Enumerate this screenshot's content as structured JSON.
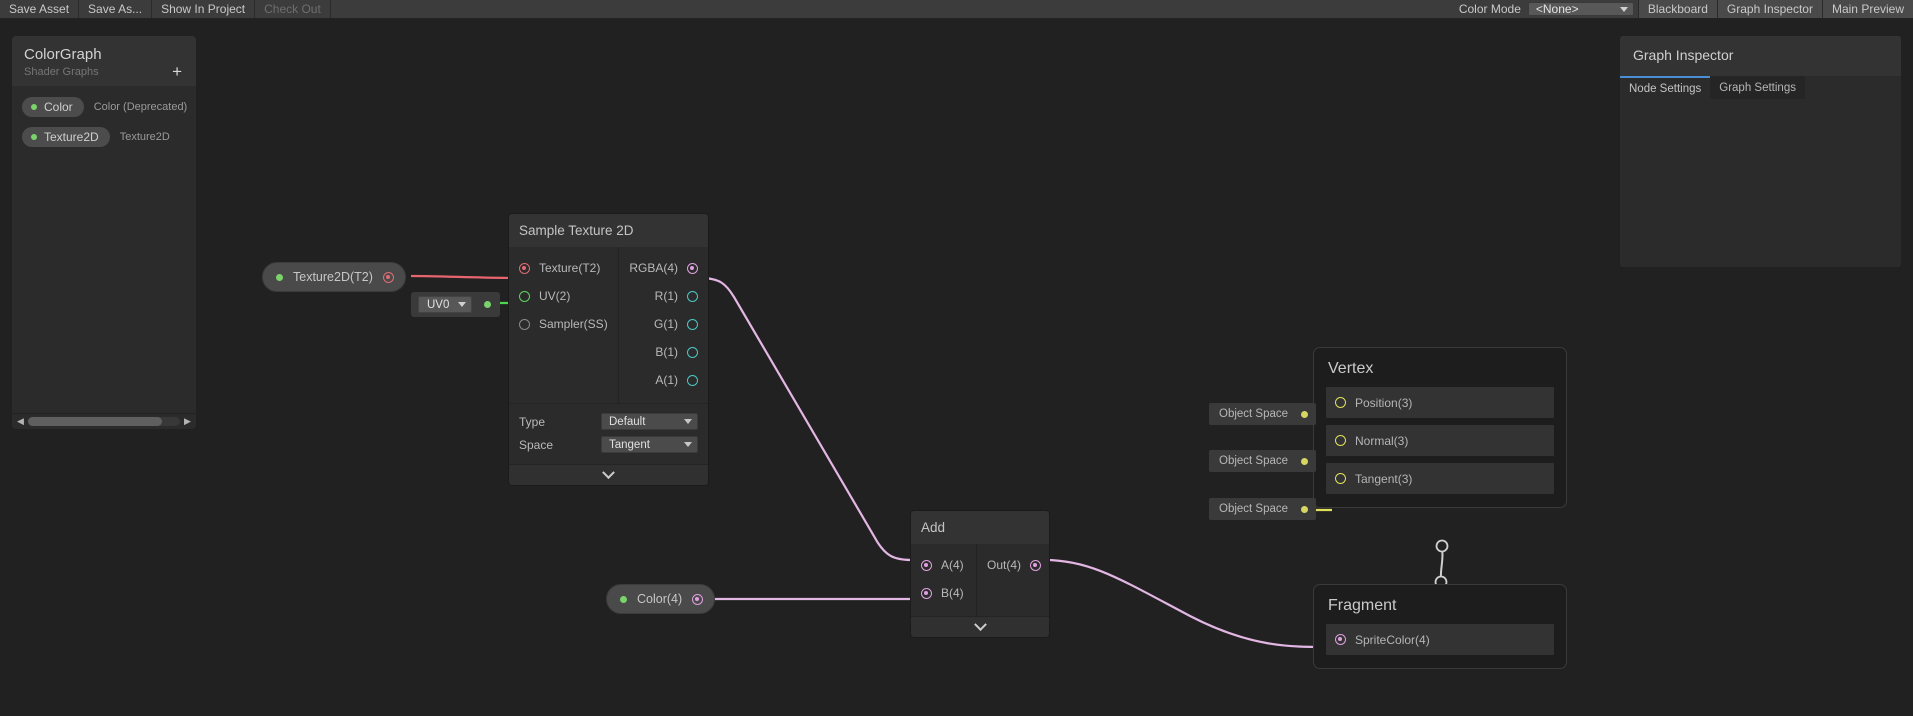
{
  "toolbar": {
    "left_buttons": [
      {
        "label": "Save Asset",
        "disabled": false
      },
      {
        "label": "Save As...",
        "disabled": false
      },
      {
        "label": "Show In Project",
        "disabled": false
      },
      {
        "label": "Check Out",
        "disabled": true
      }
    ],
    "color_mode_label": "Color Mode",
    "color_mode_value": "<None>",
    "toggles": [
      "Blackboard",
      "Graph Inspector",
      "Main Preview"
    ]
  },
  "blackboard": {
    "title": "ColorGraph",
    "subtitle": "Shader Graphs",
    "add_label": "+",
    "properties": [
      {
        "name": "Color",
        "type": "Color (Deprecated)"
      },
      {
        "name": "Texture2D",
        "type": "Texture2D"
      }
    ]
  },
  "inspector": {
    "title": "Graph Inspector",
    "tabs": [
      {
        "label": "Node Settings",
        "active": true
      },
      {
        "label": "Graph Settings",
        "active": false
      }
    ]
  },
  "nodes": {
    "sample_texture": {
      "title": "Sample Texture 2D",
      "inputs": [
        {
          "label": "Texture(T2)",
          "color": "#e06c75",
          "filled": true
        },
        {
          "label": "UV(2)",
          "color": "#5ed45e",
          "filled": false
        },
        {
          "label": "Sampler(SS)",
          "color": "#8a8a8a",
          "filled": false
        }
      ],
      "outputs": [
        {
          "label": "RGBA(4)",
          "color": "#e0a0e0",
          "filled": true
        },
        {
          "label": "R(1)",
          "color": "#4bc8c8",
          "filled": false
        },
        {
          "label": "G(1)",
          "color": "#4bc8c8",
          "filled": false
        },
        {
          "label": "B(1)",
          "color": "#4bc8c8",
          "filled": false
        },
        {
          "label": "A(1)",
          "color": "#4bc8c8",
          "filled": false
        }
      ],
      "settings": [
        {
          "label": "Type",
          "value": "Default"
        },
        {
          "label": "Space",
          "value": "Tangent"
        }
      ]
    },
    "add": {
      "title": "Add",
      "inputs": [
        {
          "label": "A(4)",
          "color": "#e0a0e0",
          "filled": true
        },
        {
          "label": "B(4)",
          "color": "#e0a0e0",
          "filled": true
        }
      ],
      "outputs": [
        {
          "label": "Out(4)",
          "color": "#e0a0e0",
          "filled": true
        }
      ]
    },
    "texture_property": {
      "label": "Texture2D(T2)",
      "port_color": "#e06c75"
    },
    "color_property": {
      "label": "Color(4)",
      "port_color": "#e0a0e0"
    },
    "uv_widget": {
      "value": "UV0"
    }
  },
  "stacks": {
    "vertex": {
      "title": "Vertex",
      "blocks": [
        {
          "label": "Position(3)",
          "space": "Object Space"
        },
        {
          "label": "Normal(3)",
          "space": "Object Space"
        },
        {
          "label": "Tangent(3)",
          "space": "Object Space"
        }
      ]
    },
    "fragment": {
      "title": "Fragment",
      "blocks": [
        {
          "label": "SpriteColor(4)",
          "space": null
        }
      ]
    }
  },
  "colors": {
    "background": "#212121",
    "panel": "#2b2b2b",
    "header": "#333333",
    "accent_blue": "#4a8fd4",
    "wire_pink": "#e3b6e3",
    "wire_red": "#e8646e",
    "wire_green": "#4fd44f",
    "wire_yellow": "#e0e05a",
    "wire_white": "#d0d0d0"
  }
}
